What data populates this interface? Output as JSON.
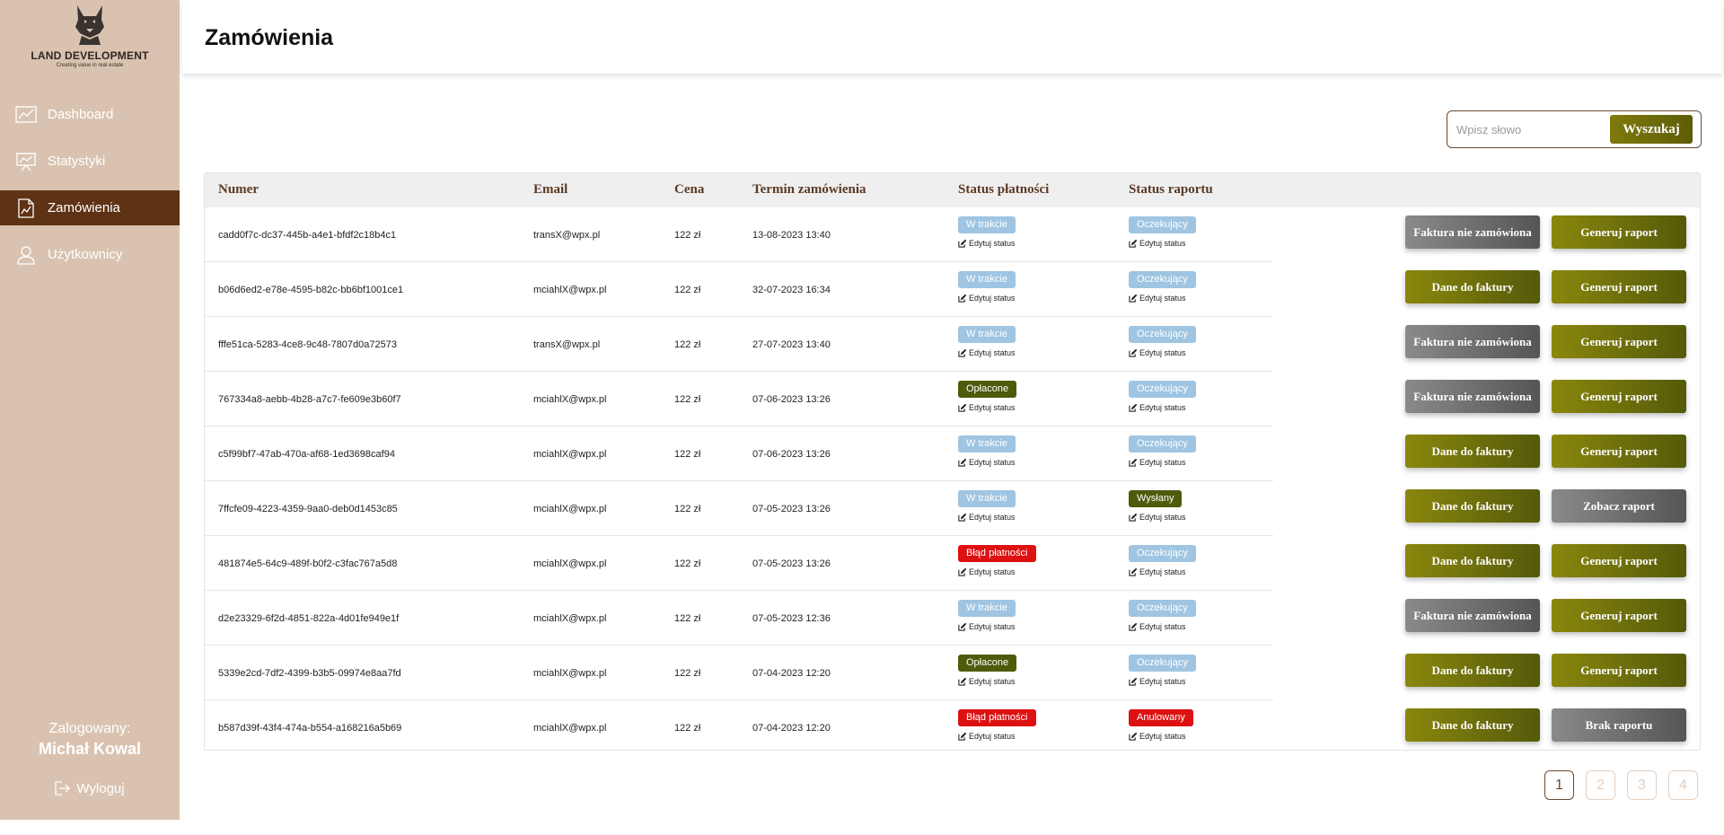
{
  "brand": {
    "title": "LAND DEVELOPMENT",
    "subtitle": "Creating value in real estate"
  },
  "page_title": "Zamówienia",
  "nav": [
    {
      "label": "Dashboard",
      "icon": "dashboard-chart-icon"
    },
    {
      "label": "Statystyki",
      "icon": "presentation-board-icon"
    },
    {
      "label": "Zamówienia",
      "icon": "document-chart-icon",
      "active": true
    },
    {
      "label": "Użytkownicy",
      "icon": "user-icon"
    }
  ],
  "user": {
    "label": "Zalogowany:",
    "name": "Michał Kowal"
  },
  "logout_label": "Wyloguj",
  "search": {
    "placeholder": "Wpisz słowo",
    "value": "",
    "button": "Wyszukaj"
  },
  "table": {
    "columns": [
      "Numer",
      "Email",
      "Cena",
      "Termin zamówienia",
      "Status płatności",
      "Status raportu"
    ],
    "edit_label": "Edytuj status",
    "rows": [
      {
        "id": "cadd0f7c-dc37-445b-a4e1-bfdf2c18b4c1",
        "email": "transX@wpx.pl",
        "price": "122 zł",
        "date": "13-08-2023 13:40",
        "payment": "W trakcie",
        "report": "Oczekujący",
        "invoice_btn": "Faktura nie zamówiona",
        "report_btn": "Generuj raport"
      },
      {
        "id": "b06d6ed2-e78e-4595-b82c-bb6bf1001ce1",
        "email": "mciahlX@wpx.pl",
        "price": "122 zł",
        "date": "32-07-2023 16:34",
        "payment": "W trakcie",
        "report": "Oczekujący",
        "invoice_btn": "Dane do faktury",
        "report_btn": "Generuj raport"
      },
      {
        "id": "fffe51ca-5283-4ce8-9c48-7807d0a72573",
        "email": "transX@wpx.pl",
        "price": "122 zł",
        "date": "27-07-2023 13:40",
        "payment": "W trakcie",
        "report": "Oczekujący",
        "invoice_btn": "Faktura nie zamówiona",
        "report_btn": "Generuj raport"
      },
      {
        "id": "767334a8-aebb-4b28-a7c7-fe609e3b60f7",
        "email": "mciahlX@wpx.pl",
        "price": "122 zł",
        "date": "07-06-2023 13:26",
        "payment": "Opłacone",
        "report": "Oczekujący",
        "invoice_btn": "Faktura nie zamówiona",
        "report_btn": "Generuj raport"
      },
      {
        "id": "c5f99bf7-47ab-470a-af68-1ed3698caf94",
        "email": "mciahlX@wpx.pl",
        "price": "122 zł",
        "date": "07-06-2023 13:26",
        "payment": "W trakcie",
        "report": "Oczekujący",
        "invoice_btn": "Dane do faktury",
        "report_btn": "Generuj raport"
      },
      {
        "id": "7ffcfe09-4223-4359-9aa0-deb0d1453c85",
        "email": "mciahlX@wpx.pl",
        "price": "122 zł",
        "date": "07-05-2023 13:26",
        "payment": "W trakcie",
        "report": "Wysłany",
        "invoice_btn": "Dane do faktury",
        "report_btn": "Zobacz raport"
      },
      {
        "id": "481874e5-64c9-489f-b0f2-c3fac767a5d8",
        "email": "mciahlX@wpx.pl",
        "price": "122 zł",
        "date": "07-05-2023 13:26",
        "payment": "Błąd płatności",
        "report": "Oczekujący",
        "invoice_btn": "Dane do faktury",
        "report_btn": "Generuj raport"
      },
      {
        "id": "d2e23329-6f2d-4851-822a-4d01fe949e1f",
        "email": "mciahlX@wpx.pl",
        "price": "122 zł",
        "date": "07-05-2023 12:36",
        "payment": "W trakcie",
        "report": "Oczekujący",
        "invoice_btn": "Faktura nie zamówiona",
        "report_btn": "Generuj raport"
      },
      {
        "id": "5339e2cd-7df2-4399-b3b5-09974e8aa7fd",
        "email": "mciahlX@wpx.pl",
        "price": "122 zł",
        "date": "07-04-2023 12:20",
        "payment": "Opłacone",
        "report": "Oczekujący",
        "invoice_btn": "Dane do faktury",
        "report_btn": "Generuj raport"
      },
      {
        "id": "b587d39f-43f4-474a-b554-a168216a5b69",
        "email": "mciahlX@wpx.pl",
        "price": "122 zł",
        "date": "07-04-2023 12:20",
        "payment": "Błąd płatności",
        "report": "Anulowany",
        "invoice_btn": "Dane do faktury",
        "report_btn": "Brak raportu"
      }
    ]
  },
  "badge_colors": {
    "W trakcie": "#9fc5e2",
    "Oczekujący": "#9fc5e2",
    "Opłacone": "#4f5a0c",
    "Wysłany": "#4f5a0c",
    "Błąd płatności": "#dd1111",
    "Anulowany": "#dd1111"
  },
  "button_styles": {
    "Generuj raport": [
      "#8a870d",
      "#545a0a"
    ],
    "Dane do faktury": [
      "#8a870d",
      "#545a0a"
    ],
    "Faktura nie zamówiona": [
      "#8a8a8a",
      "#555555"
    ],
    "Zobacz raport": [
      "#8a8a8a",
      "#555555"
    ],
    "Brak raportu": [
      "#8a8a8a",
      "#555555"
    ]
  },
  "pagination": {
    "pages": [
      "1",
      "2",
      "3",
      "4"
    ],
    "current": "1",
    "active_color": "#6c4a31",
    "inactive_color": "#e3cfc0"
  },
  "colors": {
    "sidebar": "#d9c3b0",
    "sidebar_active": "#5e3315",
    "accent_brown": "#5a3a24"
  }
}
